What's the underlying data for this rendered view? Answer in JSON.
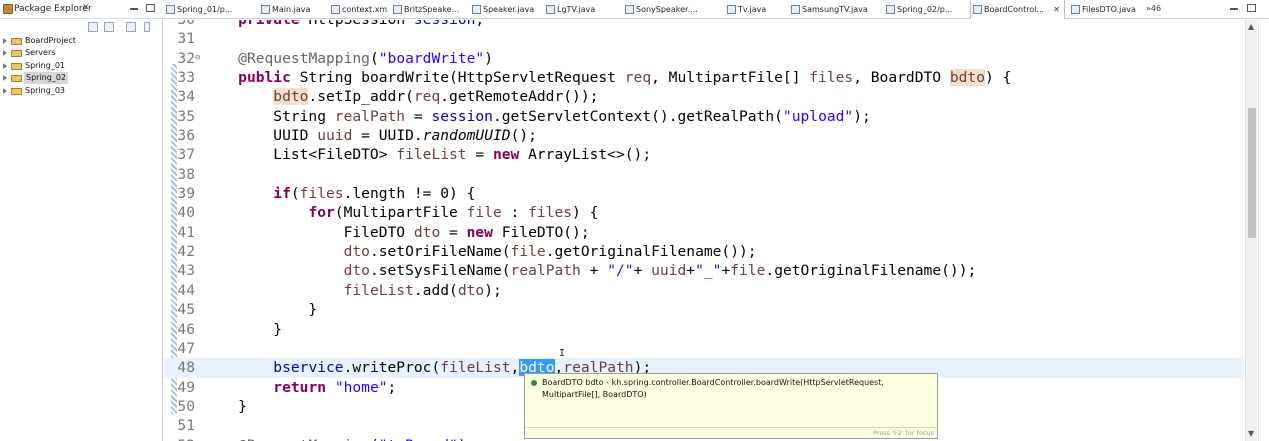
{
  "explorer": {
    "title": "Package Explorer",
    "close": "✕",
    "items": [
      {
        "label": "BoardProject",
        "selected": false
      },
      {
        "label": "Servers",
        "selected": false
      },
      {
        "label": "Spring_01",
        "selected": false
      },
      {
        "label": "Spring_02",
        "selected": true
      },
      {
        "label": "Spring_03",
        "selected": false
      }
    ]
  },
  "tabs": [
    {
      "label": "Spring_01/p...",
      "active": false
    },
    {
      "label": "Main.java",
      "active": false
    },
    {
      "label": "context.xml",
      "active": false
    },
    {
      "label": "BritzSpeake...",
      "active": false
    },
    {
      "label": "Speaker.java",
      "active": false
    },
    {
      "label": "LgTV.java",
      "active": false
    },
    {
      "label": "SonySpeaker....",
      "active": false
    },
    {
      "label": "Tv.java",
      "active": false
    },
    {
      "label": "SamsungTV.java",
      "active": false
    },
    {
      "label": "Spring_02/p...",
      "active": false
    },
    {
      "label": "BoardControl...",
      "active": true,
      "close": "✕"
    },
    {
      "label": "FilesDTO.java",
      "active": false
    }
  ],
  "overflow_tabs": "»46",
  "editor": {
    "lines": [
      {
        "num": "30",
        "fold": "",
        "text": "    private HttpSession session;"
      },
      {
        "num": "31",
        "fold": "",
        "text": ""
      },
      {
        "num": "32",
        "fold": "⊖",
        "text": "    @RequestMapping(\"boardWrite\")"
      },
      {
        "num": "33",
        "fold": "",
        "text": "    public String boardWrite(HttpServletRequest req, MultipartFile[] files, BoardDTO bdto) {"
      },
      {
        "num": "34",
        "fold": "",
        "text": "        bdto.setIp_addr(req.getRemoteAddr());"
      },
      {
        "num": "35",
        "fold": "",
        "text": "        String realPath = session.getServletContext().getRealPath(\"upload\");"
      },
      {
        "num": "36",
        "fold": "",
        "text": "        UUID uuid = UUID.randomUUID();"
      },
      {
        "num": "37",
        "fold": "",
        "text": "        List<FileDTO> fileList = new ArrayList<>();"
      },
      {
        "num": "38",
        "fold": "",
        "text": ""
      },
      {
        "num": "39",
        "fold": "",
        "text": "        if(files.length != 0) {"
      },
      {
        "num": "40",
        "fold": "",
        "text": "            for(MultipartFile file : files) {"
      },
      {
        "num": "41",
        "fold": "",
        "text": "                FileDTO dto = new FileDTO();"
      },
      {
        "num": "42",
        "fold": "",
        "text": "                dto.setOriFileName(file.getOriginalFilename());"
      },
      {
        "num": "43",
        "fold": "",
        "text": "                dto.setSysFileName(realPath + \"/\"+ uuid+\"_\"+file.getOriginalFilename());"
      },
      {
        "num": "44",
        "fold": "",
        "text": "                fileList.add(dto);"
      },
      {
        "num": "45",
        "fold": "",
        "text": "            }"
      },
      {
        "num": "46",
        "fold": "",
        "text": "        }"
      },
      {
        "num": "47",
        "fold": "",
        "text": ""
      },
      {
        "num": "48",
        "fold": "",
        "text": "        bservice.writeProc(fileList,bdto,realPath);"
      },
      {
        "num": "49",
        "fold": "",
        "text": "        return \"home\";"
      },
      {
        "num": "50",
        "fold": "",
        "text": "    }"
      },
      {
        "num": "51",
        "fold": "",
        "text": ""
      },
      {
        "num": "52",
        "fold": "⊖",
        "text": "    @RequestMapping(\"toBoard\")"
      }
    ]
  },
  "tooltip": {
    "text": "BoardDTO bdto - kh.spring.controller.BoardController.boardWrite(HttpServletRequest, MultipartFile[], BoardDTO)",
    "hint": "Press 'F2' for focus"
  },
  "scrollbar": {
    "up": "▲",
    "down": "▼"
  },
  "colors": {
    "keyword": "#7f0055",
    "string": "#2a00ff",
    "field": "#0000c0",
    "annotation": "#646464",
    "selection": "#3399ff",
    "occurrence": "#f4dfc9",
    "current_line": "#e8f2fe"
  }
}
